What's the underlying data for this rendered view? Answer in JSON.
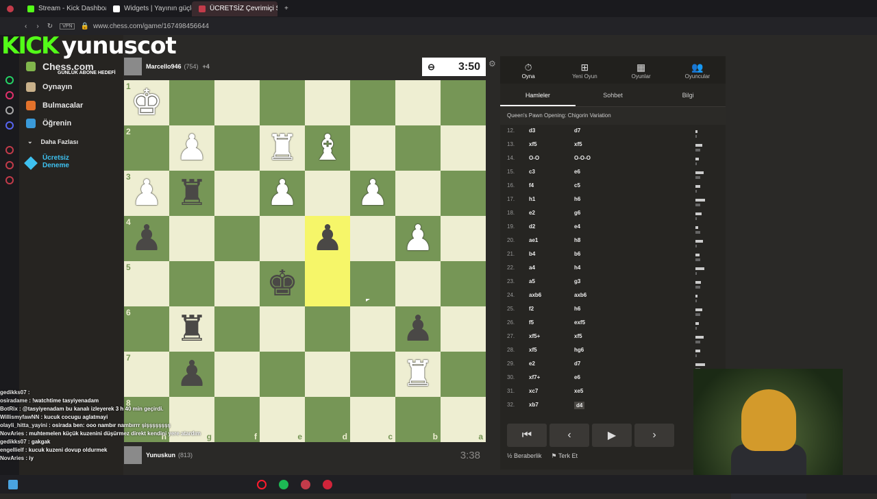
{
  "browser": {
    "tabs": [
      {
        "label": "Stream - Kick Dashboard",
        "color": "#53fc18"
      },
      {
        "label": "Widgets | Yayının güçlen",
        "color": "#ffffff"
      },
      {
        "label": "ÜCRETSİZ Çevrimiçi S",
        "color": "#c23b4a"
      }
    ],
    "url": "www.chess.com/game/167498456644",
    "vpn": "VPN"
  },
  "overlay": {
    "kick": "KICK",
    "name": "yunuscot",
    "abone": "GÜNLÜK ABONE HEDEFİ"
  },
  "nav": {
    "logo": "Chess.com",
    "items": [
      "Oynayın",
      "Bulmacalar",
      "Öğrenin",
      "Daha Fazlası",
      "Ücretsiz Deneme"
    ]
  },
  "top_player": {
    "name": "Marcello946",
    "rating": "(754)",
    "extra": "+4"
  },
  "bottom_player": {
    "name": "Yunuskun",
    "rating": "(813)"
  },
  "clock_top": "3:50",
  "clock_bottom": "3:38",
  "board": {
    "ranks": [
      "1",
      "2",
      "3",
      "4",
      "5",
      "6",
      "7",
      "8"
    ],
    "files": [
      "h",
      "g",
      "f",
      "e",
      "d",
      "c",
      "b",
      "a"
    ],
    "pieces": [
      [
        "wK",
        "",
        "",
        "",
        "",
        "",
        "",
        ""
      ],
      [
        "",
        "wP",
        "",
        "wR",
        "wB",
        "",
        "",
        ""
      ],
      [
        "wP",
        "bR",
        "",
        "wP",
        "",
        "wP",
        "",
        ""
      ],
      [
        "bP",
        "",
        "",
        "",
        "bP",
        "",
        "wP",
        ""
      ],
      [
        "",
        "",
        "",
        "bK",
        "",
        "",
        "",
        ""
      ],
      [
        "",
        "bR",
        "",
        "",
        "",
        "",
        "bP",
        ""
      ],
      [
        "",
        "bP",
        "",
        "",
        "",
        "",
        "wR",
        ""
      ],
      [
        "",
        "",
        "",
        "",
        "",
        "",
        "",
        ""
      ]
    ],
    "highlight": [
      [
        3,
        4
      ],
      [
        4,
        4
      ]
    ]
  },
  "panel": {
    "tabs": [
      "Oyna",
      "Yeni Oyun",
      "Oyunlar",
      "Oyuncular"
    ],
    "subtabs": [
      "Hamleler",
      "Sohbet",
      "Bilgi"
    ],
    "opening": "Queen's Pawn Opening: Chigorin Variation",
    "moves": [
      [
        "12.",
        "d3",
        "d7"
      ],
      [
        "13.",
        "xf5",
        "xf5"
      ],
      [
        "14.",
        "O-O",
        "O-O-O"
      ],
      [
        "15.",
        "c3",
        "e6"
      ],
      [
        "16.",
        "f4",
        "c5"
      ],
      [
        "17.",
        "h1",
        "h6"
      ],
      [
        "18.",
        "e2",
        "g6"
      ],
      [
        "19.",
        "d2",
        "e4"
      ],
      [
        "20.",
        "ae1",
        "h8"
      ],
      [
        "21.",
        "b4",
        "b6"
      ],
      [
        "22.",
        "a4",
        "h4"
      ],
      [
        "23.",
        "a5",
        "g3"
      ],
      [
        "24.",
        "axb6",
        "axb6"
      ],
      [
        "25.",
        "f2",
        "h6"
      ],
      [
        "26.",
        "f5",
        "exf5"
      ],
      [
        "27.",
        "xf5+",
        "xf5"
      ],
      [
        "28.",
        "xf5",
        "hg6"
      ],
      [
        "29.",
        "e2",
        "d7"
      ],
      [
        "30.",
        "xf7+",
        "e6"
      ],
      [
        "31.",
        "xc7",
        "xe5"
      ],
      [
        "32.",
        "xb7",
        "d4"
      ]
    ],
    "actions": [
      "Beraberlik",
      "Terk Et"
    ]
  },
  "chat": [
    {
      "user": "gedikks07",
      "msg": ""
    },
    {
      "user": "osiradame",
      "msg": "!watchtime tasyiyenadam"
    },
    {
      "user": "BotRix",
      "msg": "@tasyiyenadam bu kanalı izleyerek 3 h 40 min geçirdi."
    },
    {
      "user": "WillismyfawNN",
      "msg": "kucuk cocugu aglatmayi"
    },
    {
      "user": "olayli_hitta_yayini",
      "msg": "osirada ben: ooo nambır nambırrr şişşşşşşşş"
    },
    {
      "user": "NovAries",
      "msg": "muhtemelen küçük kuzenini düşürmez direkt kendini yere atardım"
    },
    {
      "user": "gedikks07",
      "msg": "gakgak"
    },
    {
      "user": "engellielf",
      "msg": "kucuk kuzeni dovup oldurmek"
    },
    {
      "user": "NovAries",
      "msg": "iy"
    }
  ]
}
